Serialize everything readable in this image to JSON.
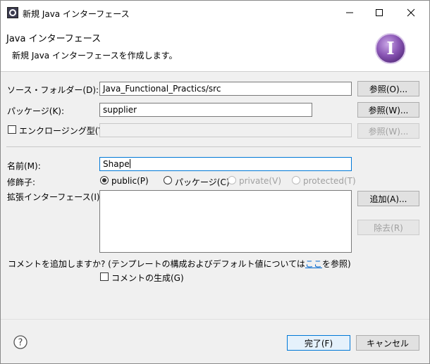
{
  "window": {
    "title": "新規 Java インターフェース"
  },
  "banner": {
    "title": "Java インターフェース",
    "description": "新規 Java インターフェースを作成します。",
    "logo_letter": "I"
  },
  "form": {
    "source_folder": {
      "label": "ソース・フォルダー(D):",
      "value": "Java_Functional_Practics/src",
      "browse": "参照(O)..."
    },
    "package": {
      "label": "パッケージ(K):",
      "value": "supplier",
      "browse": "参照(W)..."
    },
    "enclosing": {
      "label": "エンクロージング型(Y):",
      "value": "",
      "browse": "参照(W)..."
    },
    "name": {
      "label": "名前(M):",
      "value": "Shape"
    },
    "modifiers": {
      "label": "修飾子:",
      "options": [
        "public(P)",
        "パッケージ(C)",
        "private(V)",
        "protected(T)"
      ]
    },
    "extended": {
      "label": "拡張インターフェース(I):",
      "add": "追加(A)...",
      "remove": "除去(R)"
    },
    "comment_prompt_before": "コメントを追加しますか? (テンプレートの構成およびデフォルト値については",
    "comment_prompt_link": "ここ",
    "comment_prompt_after": "を参照)",
    "generate_comments": "コメントの生成(G)"
  },
  "footer": {
    "help": "?",
    "finish": "完了(F)",
    "cancel": "キャンセル"
  },
  "colors": {
    "accent": "#0078d7",
    "logo_purple": "#7e4fa3"
  }
}
